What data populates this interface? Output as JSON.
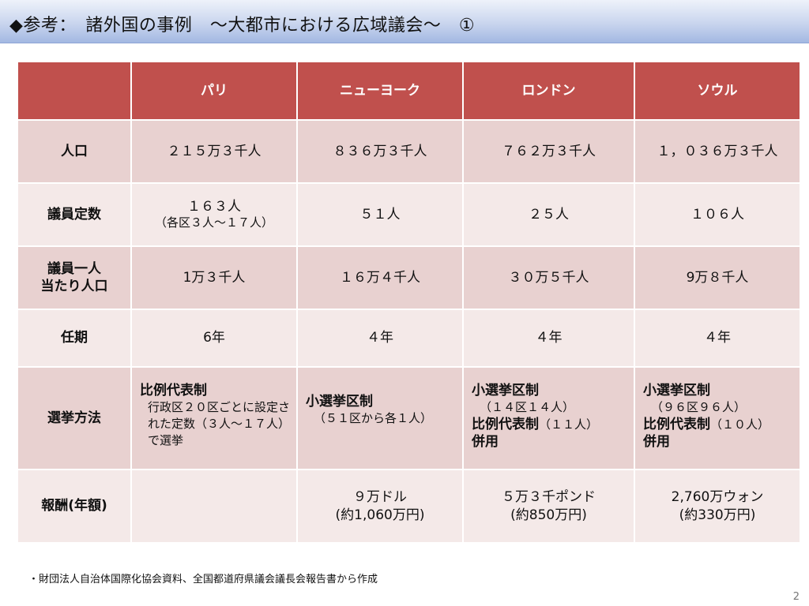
{
  "header": {
    "title": "◆参考：　諸外国の事例　～大都市における広域議会～　①"
  },
  "table": {
    "corner": "",
    "columns": [
      "パリ",
      "ニューヨーク",
      "ロンドン",
      "ソウル"
    ],
    "rows": {
      "population": {
        "label": "人口",
        "cells": [
          "２１５万３千人",
          "８３６万３千人",
          "７６２万３千人",
          "１，０３６万３千人"
        ]
      },
      "seats": {
        "label": "議員定数",
        "paris_main": "１６３人",
        "paris_sub": "（各区３人～１７人）",
        "newyork": "５１人",
        "london": "２５人",
        "seoul": "１０６人"
      },
      "per_member": {
        "label_line1": "議員一人",
        "label_line2": "当たり人口",
        "cells": [
          "1万３千人",
          "１６万４千人",
          "３０万５千人",
          "9万８千人"
        ]
      },
      "term": {
        "label": "任期",
        "cells": [
          "6年",
          "４年",
          "４年",
          "４年"
        ]
      },
      "election": {
        "label": "選挙方法",
        "paris_bold": "比例代表制",
        "paris_desc": "行政区２０区ごとに設定された定数（３人～１７人）で選挙",
        "newyork_bold": "小選挙区制",
        "newyork_desc": "（５１区から各１人）",
        "london_bold1": "小選挙区制",
        "london_desc1": "（１４区１４人）",
        "london_bold2": "比例代表制",
        "london_desc2": "（１１人）",
        "london_bold3": "併用",
        "seoul_bold1": "小選挙区制",
        "seoul_desc1": "（９６区９６人）",
        "seoul_bold2": "比例代表制",
        "seoul_desc2": "（１０人）",
        "seoul_bold3": "併用"
      },
      "salary": {
        "label": "報酬(年額)",
        "paris": "",
        "newyork_line1": "９万ドル",
        "newyork_line2": "(約1,060万円)",
        "london_line1": "５万３千ポンド",
        "london_line2": "(約850万円)",
        "seoul_line1": "2,760万ウォン",
        "seoul_line2": "(約330万円)"
      }
    }
  },
  "footer": {
    "note": "・財団法人自治体国際化協会資料、全国都道府県議会議長会報告書から作成",
    "page_number": "2"
  }
}
